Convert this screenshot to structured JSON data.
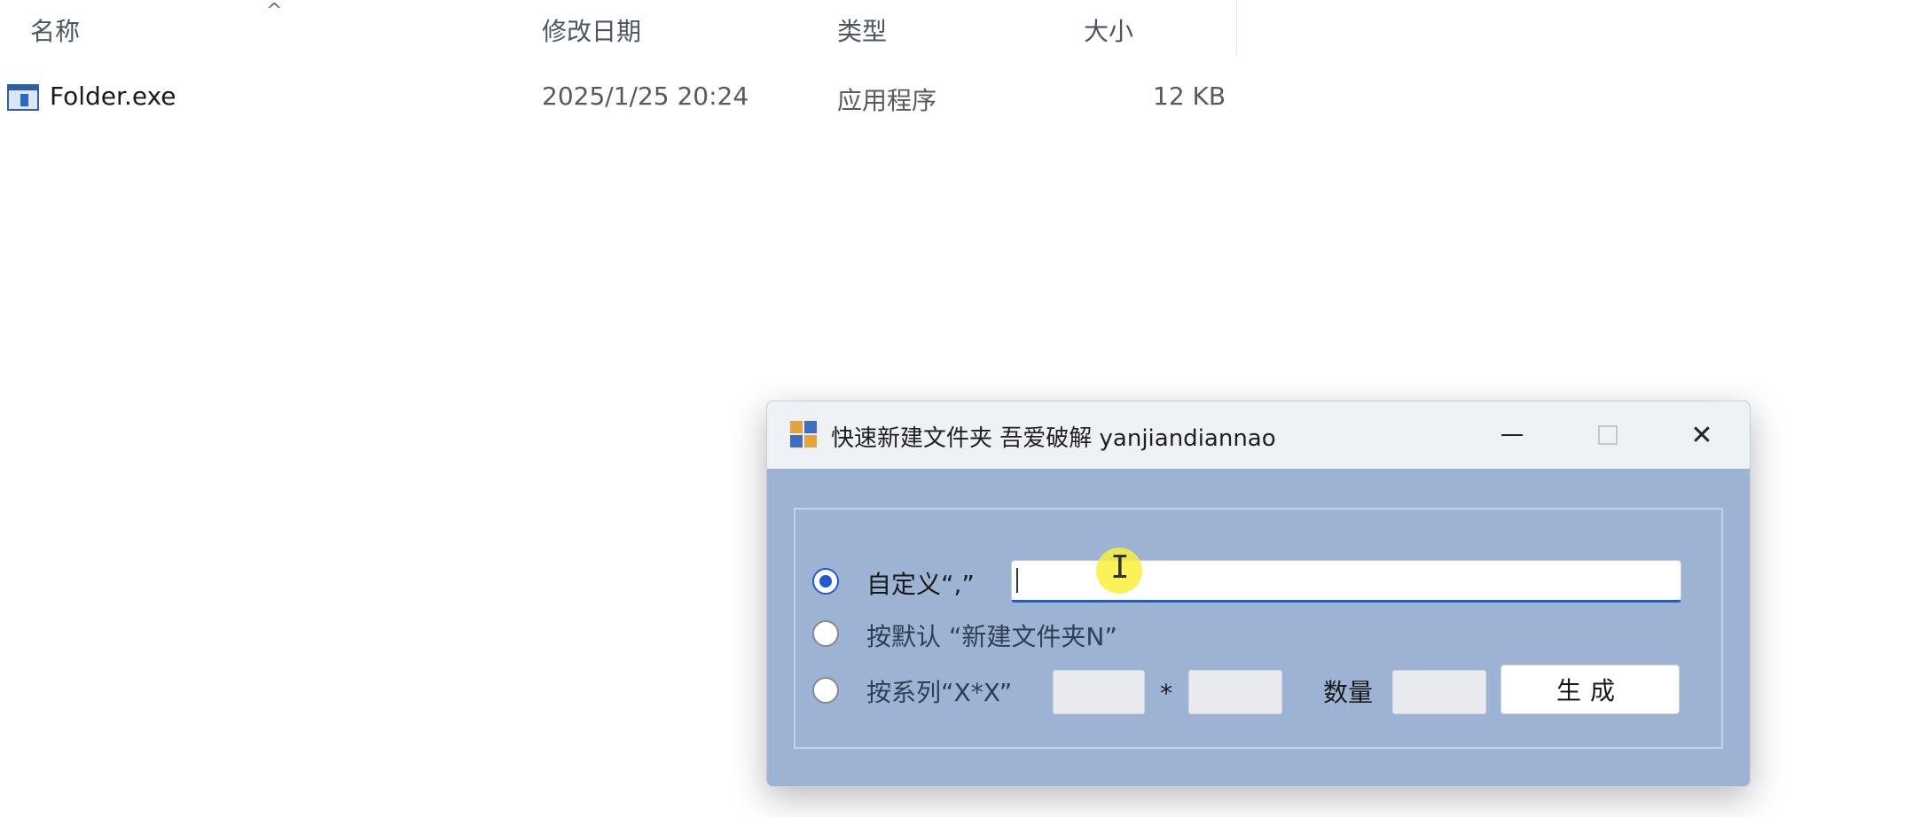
{
  "explorer": {
    "columns": {
      "name": "名称",
      "modified": "修改日期",
      "type": "类型",
      "size": "大小"
    },
    "files": [
      {
        "name": "Folder.exe",
        "modified": "2025/1/25 20:24",
        "type": "应用程序",
        "size": "12 KB",
        "icon": "exe-file-icon"
      }
    ]
  },
  "dialog": {
    "title": "快速新建文件夹 吾爱破解 yanjiandiannao",
    "options": [
      {
        "label": "自定义“,”",
        "checked": true
      },
      {
        "label": "按默认 “新建文件夹N”",
        "checked": false
      },
      {
        "label": "按系列“X*X”",
        "checked": false
      }
    ],
    "custom_input_value": "",
    "multiply_sign": "*",
    "quantity_label": "数量",
    "generate_button": "生成",
    "controls": {
      "minimize": "minimize-icon",
      "maximize": "maximize-icon",
      "close": "✕"
    },
    "colors": {
      "client_bg": "#9cb3d3",
      "titlebar_bg": "#eef1f6",
      "accent": "#1e5bd0"
    }
  }
}
